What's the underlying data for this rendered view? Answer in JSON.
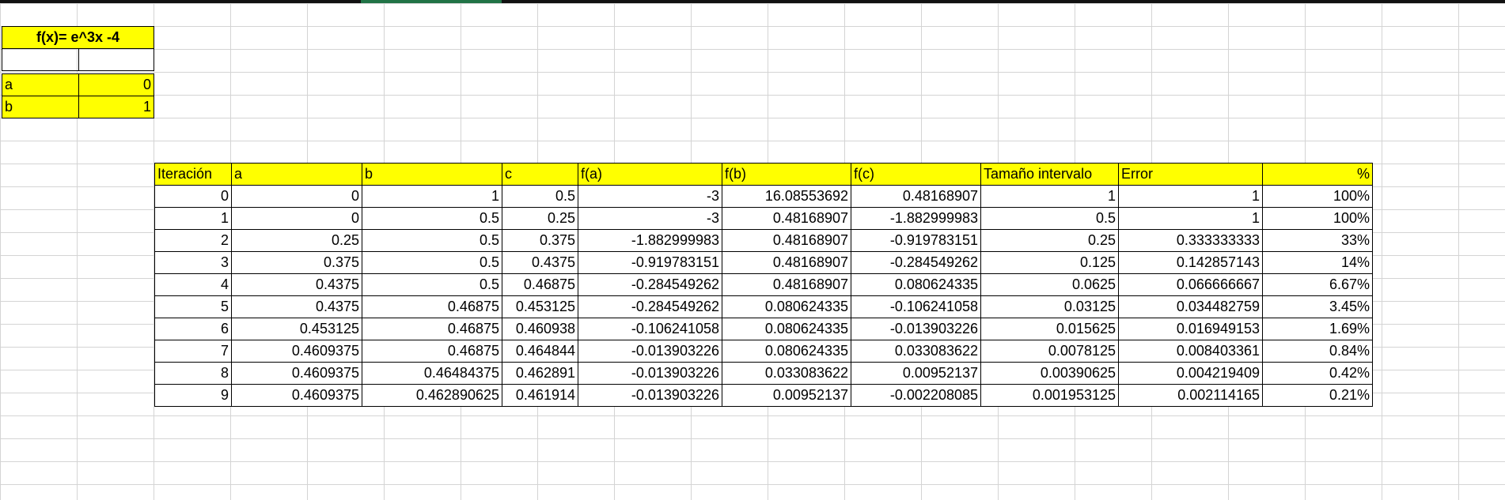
{
  "function_box": {
    "title": "f(x)= e^3x -4",
    "params": [
      {
        "label": "a",
        "value": "0"
      },
      {
        "label": "b",
        "value": "1"
      }
    ]
  },
  "table": {
    "headers": [
      "Iteración",
      "a",
      "b",
      "c",
      "f(a)",
      "f(b)",
      "f(c)",
      "Tamaño intervalo",
      "Error",
      "%"
    ],
    "rows": [
      [
        "0",
        "0",
        "1",
        "0.5",
        "-3",
        "16.08553692",
        "0.48168907",
        "1",
        "1",
        "100%"
      ],
      [
        "1",
        "0",
        "0.5",
        "0.25",
        "-3",
        "0.48168907",
        "-1.882999983",
        "0.5",
        "1",
        "100%"
      ],
      [
        "2",
        "0.25",
        "0.5",
        "0.375",
        "-1.882999983",
        "0.48168907",
        "-0.919783151",
        "0.25",
        "0.333333333",
        "33%"
      ],
      [
        "3",
        "0.375",
        "0.5",
        "0.4375",
        "-0.919783151",
        "0.48168907",
        "-0.284549262",
        "0.125",
        "0.142857143",
        "14%"
      ],
      [
        "4",
        "0.4375",
        "0.5",
        "0.46875",
        "-0.284549262",
        "0.48168907",
        "0.080624335",
        "0.0625",
        "0.066666667",
        "6.67%"
      ],
      [
        "5",
        "0.4375",
        "0.46875",
        "0.453125",
        "-0.284549262",
        "0.080624335",
        "-0.106241058",
        "0.03125",
        "0.034482759",
        "3.45%"
      ],
      [
        "6",
        "0.453125",
        "0.46875",
        "0.460938",
        "-0.106241058",
        "0.080624335",
        "-0.013903226",
        "0.015625",
        "0.016949153",
        "1.69%"
      ],
      [
        "7",
        "0.4609375",
        "0.46875",
        "0.464844",
        "-0.013903226",
        "0.080624335",
        "0.033083622",
        "0.0078125",
        "0.008403361",
        "0.84%"
      ],
      [
        "8",
        "0.4609375",
        "0.46484375",
        "0.462891",
        "-0.013903226",
        "0.033083622",
        "0.00952137",
        "0.00390625",
        "0.004219409",
        "0.42%"
      ],
      [
        "9",
        "0.4609375",
        "0.462890625",
        "0.461914",
        "-0.013903226",
        "0.00952137",
        "-0.002208085",
        "0.001953125",
        "0.002114165",
        "0.21%"
      ]
    ]
  }
}
